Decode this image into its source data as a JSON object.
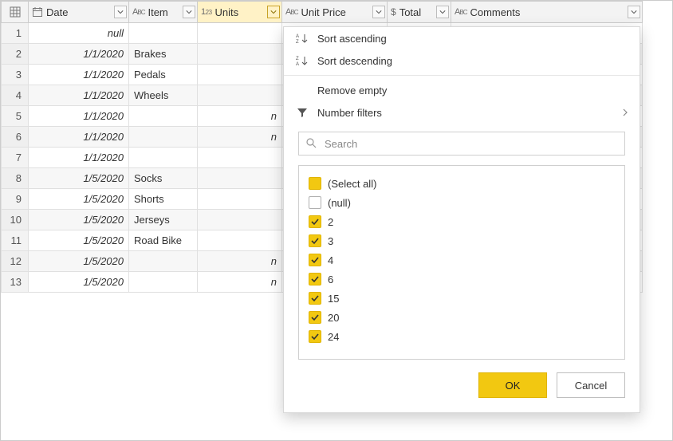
{
  "columns": {
    "date": {
      "label": "Date",
      "type": "date"
    },
    "item": {
      "label": "Item",
      "type": "text"
    },
    "units": {
      "label": "Units",
      "type": "number",
      "active": true
    },
    "unit_price": {
      "label": "Unit Price",
      "type": "text"
    },
    "total": {
      "label": "Total",
      "type": "currency"
    },
    "comments": {
      "label": "Comments",
      "type": "text"
    }
  },
  "rows": [
    {
      "n": "1",
      "date": "null",
      "date_is_null": true,
      "item": "",
      "units_peek": ""
    },
    {
      "n": "2",
      "date": "1/1/2020",
      "item": "Brakes",
      "units_peek": ""
    },
    {
      "n": "3",
      "date": "1/1/2020",
      "item": "Pedals",
      "units_peek": ""
    },
    {
      "n": "4",
      "date": "1/1/2020",
      "item": "Wheels",
      "units_peek": ""
    },
    {
      "n": "5",
      "date": "1/1/2020",
      "item": "",
      "units_peek": "n"
    },
    {
      "n": "6",
      "date": "1/1/2020",
      "item": "",
      "units_peek": "n"
    },
    {
      "n": "7",
      "date": "1/1/2020",
      "item": "",
      "units_peek": ""
    },
    {
      "n": "8",
      "date": "1/5/2020",
      "item": "Socks",
      "units_peek": ""
    },
    {
      "n": "9",
      "date": "1/5/2020",
      "item": "Shorts",
      "units_peek": ""
    },
    {
      "n": "10",
      "date": "1/5/2020",
      "item": "Jerseys",
      "units_peek": ""
    },
    {
      "n": "11",
      "date": "1/5/2020",
      "item": "Road Bike",
      "units_peek": ""
    },
    {
      "n": "12",
      "date": "1/5/2020",
      "item": "",
      "units_peek": "n"
    },
    {
      "n": "13",
      "date": "1/5/2020",
      "item": "",
      "units_peek": "n"
    }
  ],
  "filter_menu": {
    "sort_asc": "Sort ascending",
    "sort_desc": "Sort descending",
    "remove_empty": "Remove empty",
    "number_filters": "Number filters",
    "search_placeholder": "Search",
    "select_all_label": "(Select all)",
    "values": [
      {
        "label": "(null)",
        "checked": false
      },
      {
        "label": "2",
        "checked": true
      },
      {
        "label": "3",
        "checked": true
      },
      {
        "label": "4",
        "checked": true
      },
      {
        "label": "6",
        "checked": true
      },
      {
        "label": "15",
        "checked": true
      },
      {
        "label": "20",
        "checked": true
      },
      {
        "label": "24",
        "checked": true
      }
    ],
    "ok_label": "OK",
    "cancel_label": "Cancel"
  }
}
